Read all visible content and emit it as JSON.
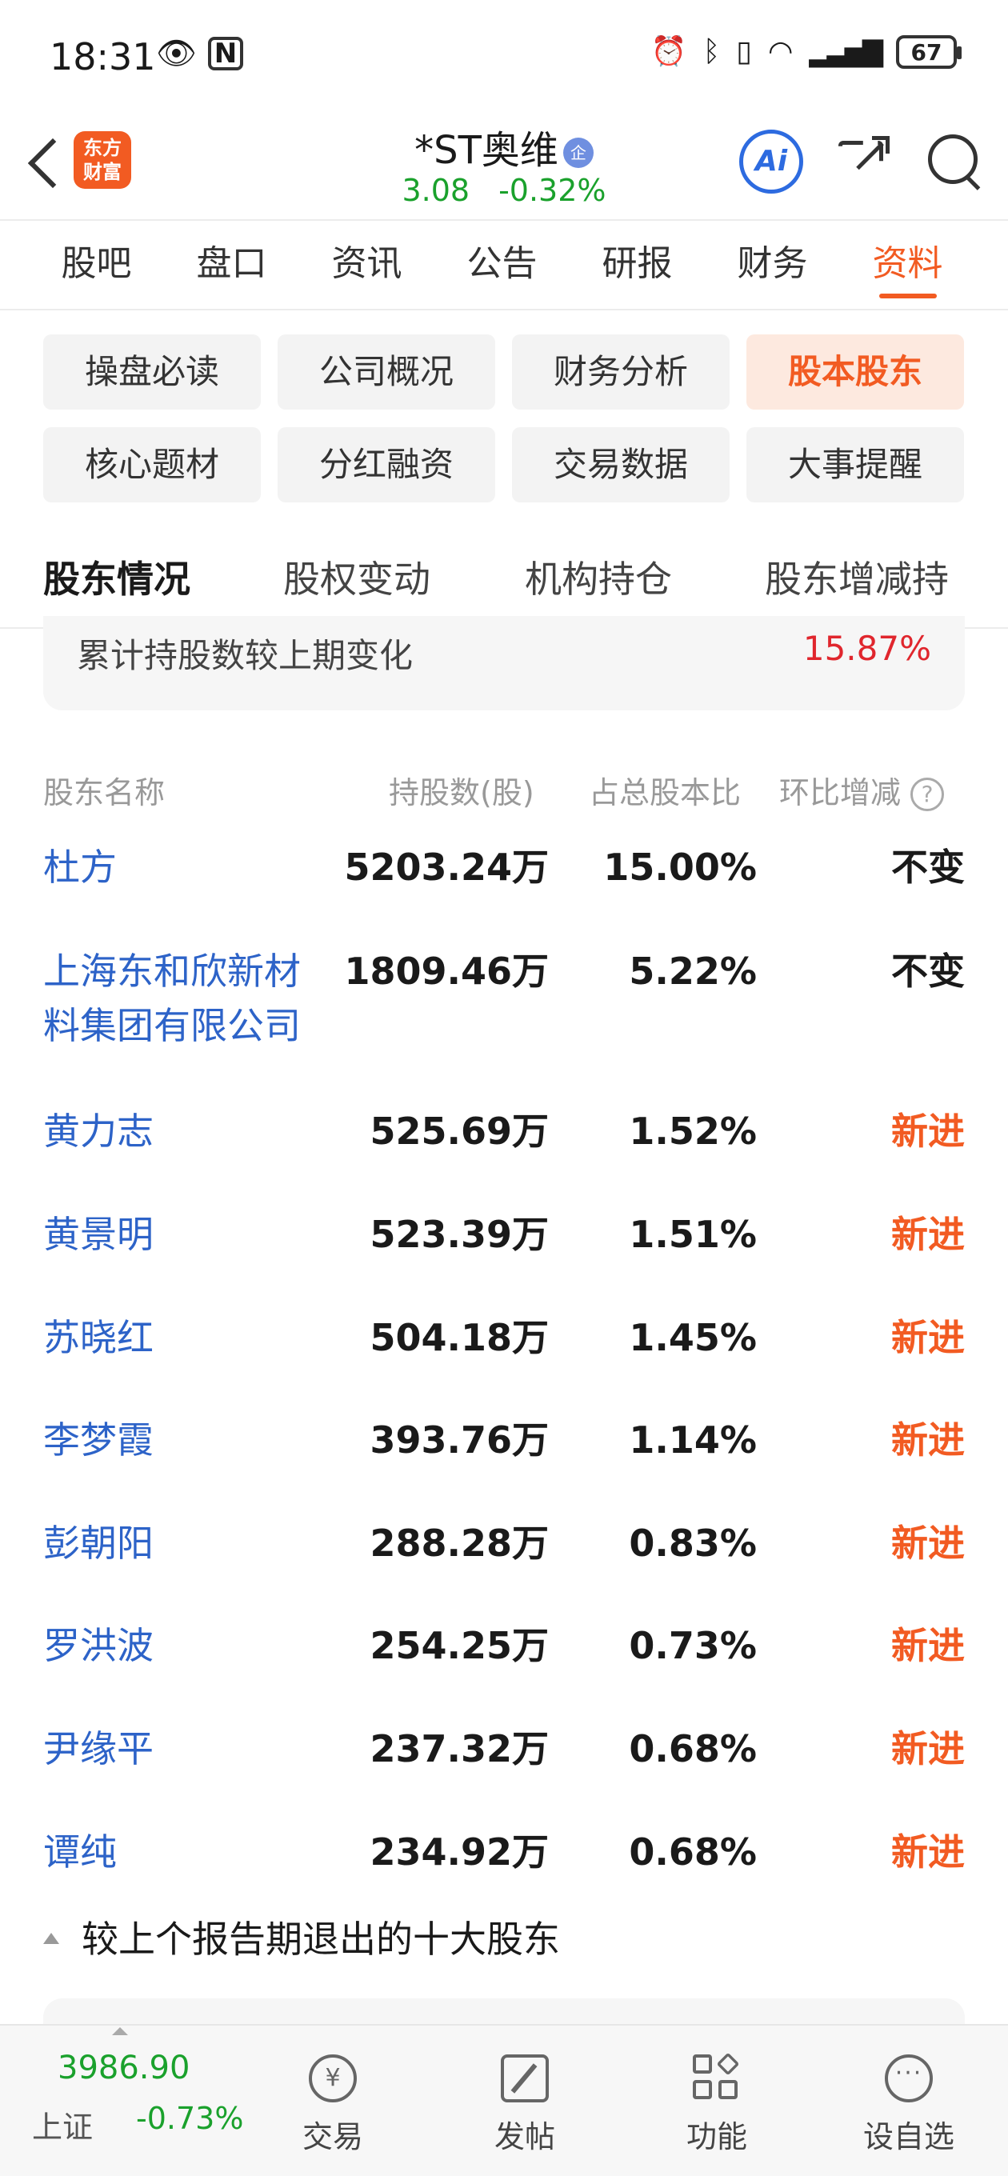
{
  "status_bar": {
    "time": "18:31",
    "battery": "67"
  },
  "header": {
    "app_logo_text": "东方\n财富",
    "stock_name": "*ST奥维",
    "badge": "企",
    "price": "3.08",
    "change_pct": "-0.32%",
    "ai_label": "Ai"
  },
  "main_tabs": [
    "股吧",
    "盘口",
    "资讯",
    "公告",
    "研报",
    "财务",
    "资料"
  ],
  "main_tab_active": "资料",
  "sub_buttons": [
    "操盘必读",
    "公司概况",
    "财务分析",
    "股本股东",
    "核心题材",
    "分红融资",
    "交易数据",
    "大事提醒"
  ],
  "sub_button_active": "股本股东",
  "section_tabs": [
    "股东情况",
    "股权变动",
    "机构持仓",
    "股东增减持"
  ],
  "section_tab_active": "股东情况",
  "summary": {
    "label": "累计持股数较上期变化",
    "value": "15.87%"
  },
  "table": {
    "headers": {
      "name": "股东名称",
      "shares": "持股数(股)",
      "ratio": "占总股本比",
      "change": "环比增减"
    },
    "rows": [
      {
        "name": "杜方",
        "shares": "5203.24万",
        "ratio": "15.00%",
        "change": "不变"
      },
      {
        "name": "上海东和欣新材料集团有限公司",
        "shares": "1809.46万",
        "ratio": "5.22%",
        "change": "不变"
      },
      {
        "name": "黄力志",
        "shares": "525.69万",
        "ratio": "1.52%",
        "change": "新进"
      },
      {
        "name": "黄景明",
        "shares": "523.39万",
        "ratio": "1.51%",
        "change": "新进"
      },
      {
        "name": "苏晓红",
        "shares": "504.18万",
        "ratio": "1.45%",
        "change": "新进"
      },
      {
        "name": "李梦霞",
        "shares": "393.76万",
        "ratio": "1.14%",
        "change": "新进"
      },
      {
        "name": "彭朝阳",
        "shares": "288.28万",
        "ratio": "0.83%",
        "change": "新进"
      },
      {
        "name": "罗洪波",
        "shares": "254.25万",
        "ratio": "0.73%",
        "change": "新进"
      },
      {
        "name": "尹缘平",
        "shares": "237.32万",
        "ratio": "0.68%",
        "change": "新进"
      },
      {
        "name": "谭纯",
        "shares": "234.92万",
        "ratio": "0.68%",
        "change": "新进"
      }
    ]
  },
  "exit_section": {
    "label": "较上个报告期退出的十大股东"
  },
  "bottom_bar": {
    "index_value": "3986.90",
    "index_name": "上证",
    "index_change": "-0.73%",
    "nav": [
      {
        "label": "交易",
        "icon": "yuan-exchange-icon"
      },
      {
        "label": "发帖",
        "icon": "edit-icon"
      },
      {
        "label": "功能",
        "icon": "grid-icon"
      },
      {
        "label": "设自选",
        "icon": "more-icon"
      }
    ]
  },
  "colors": {
    "accent": "#f25b22",
    "up_red": "#e0262d",
    "down_green": "#1aa12c",
    "link_blue": "#2d63c8"
  }
}
